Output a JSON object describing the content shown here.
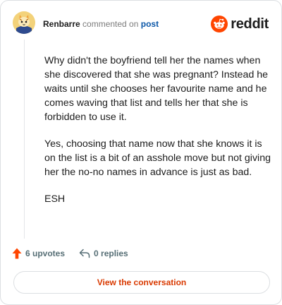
{
  "comment": {
    "username": "Renbarre",
    "action_text": "commented on",
    "target_text": "post",
    "paragraphs": [
      "Why didn't the boyfriend tell her the names when she discovered that she was pregnant? Instead he waits until she chooses her favourite name and he comes waving that list and tells her that she is forbidden to use it.",
      "Yes, choosing that name now that she knows it is on the list is a bit of an asshole move but not giving her the no-no names in advance is just as bad.",
      "ESH"
    ],
    "upvotes_label": "6 upvotes",
    "replies_label": "0 replies",
    "avatar_icon": "cat-avatar-icon"
  },
  "brand": {
    "name": "reddit",
    "icon": "reddit-snoo-icon",
    "color": "#ff4500"
  },
  "footer": {
    "view_button_label": "View the conversation"
  },
  "colors": {
    "upvote_accent": "#ff4500",
    "link_blue": "#0b57a8",
    "button_text": "#d93900"
  }
}
